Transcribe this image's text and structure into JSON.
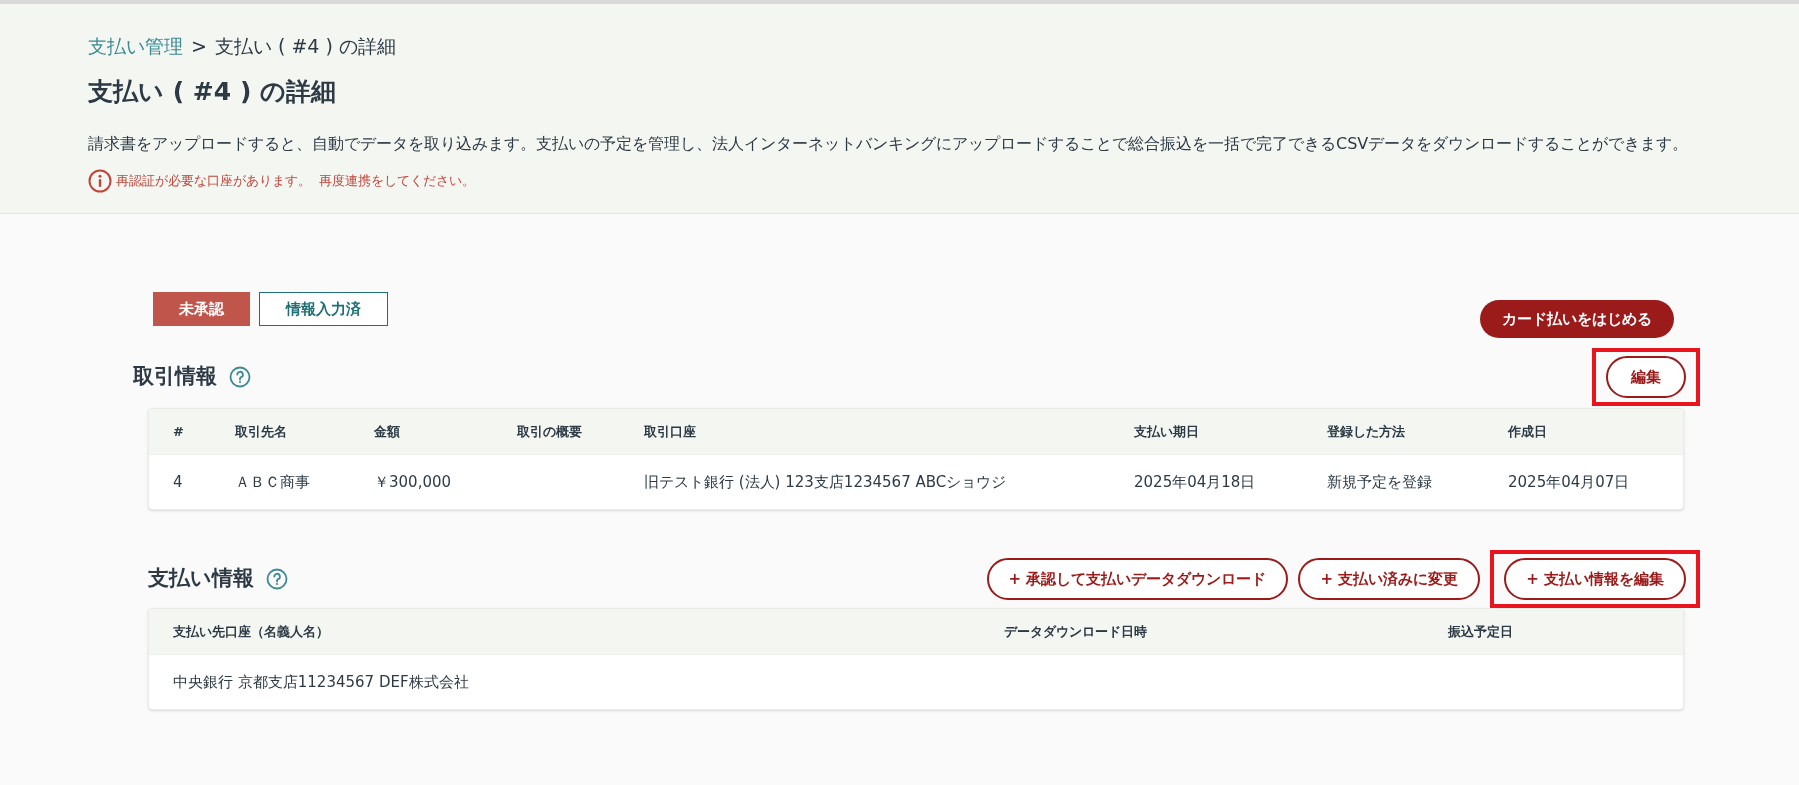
{
  "breadcrumb": {
    "parent": "支払い管理",
    "separator": ">",
    "current": "支払い ( #4 ) の詳細"
  },
  "title": "支払い ( #4 ) の詳細",
  "description": "請求書をアップロードすると、自動でデータを取り込みます。支払いの予定を管理し、法人インターネットバンキングにアップロードすることで総合振込を一括で完了できるCSVデータをダウンロードすることができます。",
  "warning": {
    "message": "再認証が必要な口座があります。",
    "link": "再度連携をしてください。"
  },
  "badges": [
    {
      "label": "未承認",
      "kind": "filled"
    },
    {
      "label": "情報入力済",
      "kind": "outline"
    }
  ],
  "card_button": "カード払いをはじめる",
  "transaction": {
    "heading": "取引情報",
    "edit_button": {
      "label": "編集",
      "highlighted": true
    },
    "columns": [
      "#",
      "取引先名",
      "金額",
      "取引の概要",
      "取引口座",
      "支払い期日",
      "登録した方法",
      "作成日"
    ],
    "rows": [
      [
        "4",
        "ＡＢＣ商事",
        "￥300,000",
        "",
        "旧テスト銀行 (法人) 123支店1234567 ABCショウジ",
        "2025年04月18日",
        "新規予定を登録",
        "2025年04月07日"
      ]
    ]
  },
  "payment": {
    "heading": "支払い情報",
    "buttons": [
      {
        "label": "+ 承認して支払いデータダウンロード",
        "highlighted": false
      },
      {
        "label": "+ 支払い済みに変更",
        "highlighted": false
      },
      {
        "label": "+ 支払い情報を編集",
        "highlighted": true
      }
    ],
    "columns": [
      "支払い先口座（名義人名）",
      "データダウンロード日時",
      "振込予定日"
    ],
    "rows": [
      [
        "中央銀行 京都支店11234567 DEF株式会社",
        "",
        ""
      ]
    ]
  }
}
